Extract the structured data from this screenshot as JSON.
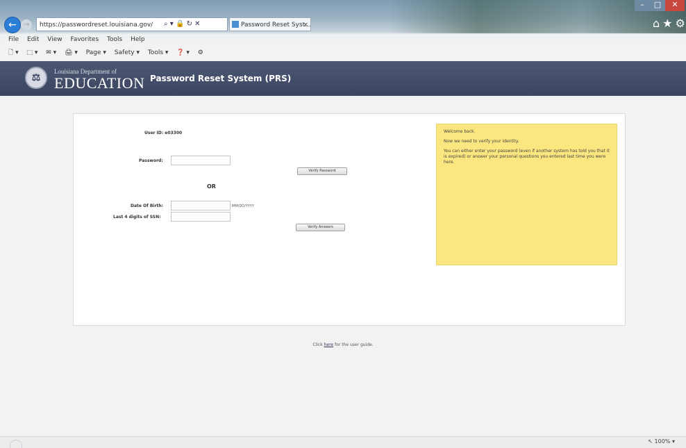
{
  "browser": {
    "address_url": "https://passwordreset.louisiana.gov/",
    "address_icons": "⌕ ▾ 🔒 ↻ ✕",
    "tab_title": "Password Reset Syst...",
    "tab_close": "×",
    "window_controls": {
      "minimize": "–",
      "maximize": "□",
      "close": "✕"
    },
    "home_icons": "⌂★⚙",
    "menu": [
      "File",
      "Edit",
      "View",
      "Favorites",
      "Tools",
      "Help"
    ],
    "commands": [
      "🗋 ▾",
      "⬚ ▾",
      "✉ ▾",
      "🖨 ▾",
      "Page ▾",
      "Safety ▾",
      "Tools ▾",
      "❓ ▾",
      "⚙"
    ],
    "zoom": "↖ 100%  ▾"
  },
  "header": {
    "seal_glyph": "⚖",
    "dept_top": "Louisiana Department of",
    "dept_main": "EDUCATION",
    "system_title": "Password Reset System (PRS)"
  },
  "form": {
    "user_id_label": "User ID: e03300",
    "password_label": "Password:",
    "verify_password_button": "Verify Password",
    "or_label": "OR",
    "dob_label": "Date Of Birth:",
    "dob_hint": "MM/DD/YYYY",
    "ssn_label": "Last 4 digits of SSN:",
    "verify_answers_button": "Verify Answers"
  },
  "info_panel": {
    "line1": "Welcome back.",
    "line2": "Now we need to verify your identity.",
    "line3": "You can either enter your password (even if another system has told you that it is expired) or answer your personal questions you entered last time you were here."
  },
  "footer": {
    "prefix": "Click ",
    "link": "here",
    "suffix": " for the user guide."
  }
}
